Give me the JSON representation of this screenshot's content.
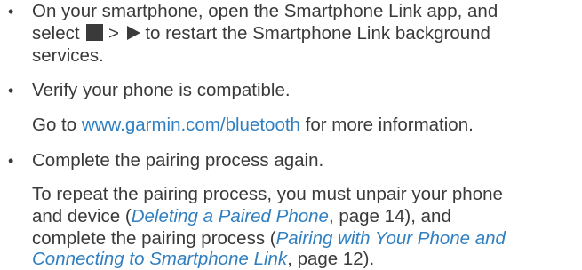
{
  "item1": {
    "line1": "On your smartphone, open the Smartphone Link app, and",
    "line2_pre": "select",
    "separator": ">",
    "line2_post": "to restart the Smartphone Link background",
    "line3": "services.",
    "icons": [
      "stop-square-icon",
      "play-triangle-icon"
    ]
  },
  "item2": {
    "line1": "Verify your phone is compatible.",
    "line2_pre": "Go to ",
    "link": "www.garmin.com/bluetooth",
    "line2_post": " for more information."
  },
  "item3": {
    "line1": "Complete the pairing process again.",
    "line2": "To repeat the pairing process, you must unpair your phone",
    "line3_pre": "and device (",
    "ref1_title": "Deleting a Paired Phone",
    "ref1_page": ", page 14), and",
    "line4_pre": "complete the pairing process (",
    "ref2_title_a": "Pairing with Your Phone and",
    "ref2_title_b": "Connecting to Smartphone Link",
    "ref2_page": ", page 12)."
  },
  "bullet_symbol": "•",
  "colors": {
    "text": "#3a3a3a",
    "link": "#2f7fc1"
  }
}
